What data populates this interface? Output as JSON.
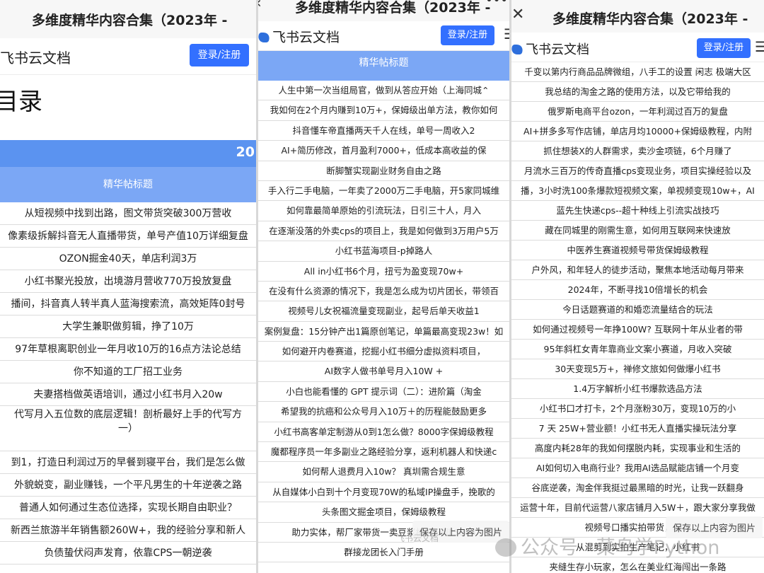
{
  "doc_title": "多维度精华内容合集（2023年 -",
  "app_name": "飞书云文档",
  "login_label": "登录/注册",
  "panel1": {
    "toc_heading": "目录",
    "year_fragment": "20",
    "column_header": "精华帖标题",
    "rows": [
      "从短视频中找到出路，图文带货突破300万营收",
      "像素级拆解抖音无人直播带货，单号产值10万详细复盘",
      "OZON掘金40天，单店利润3万",
      "小红书聚光投放，出境游月营收770万投放复盘",
      "播间，抖音真人转半真人蓝海搜索流，高效矩阵0封号",
      "大学生兼职做剪辑，挣了10万",
      "97年草根离职创业一年月收10万的16点方法论总结",
      "你不知道的工厂招工业务",
      "夫妻搭档做英语培训，通过小红书月入20w",
      "代写月入五位数的底层逻辑！剖析最好上手的代写方\n一）",
      "到1，打造日利润过万的早餐到寝平台，我们是怎么做",
      "外貌蜕变，副业赚钱，一个平凡男生的十年逆袭之路",
      "普通人如何通过生态位选择，实现长期自由职业？",
      "新西兰旅游半年销售额260W+，我的经验分享和新人",
      "负债蛰伏闷声发育，依靠CPS一朝逆袭"
    ]
  },
  "panel2": {
    "column_header": "精华帖标题",
    "rows": [
      "人生中第一次当组局官，做到从答应开始（上海同城⌃",
      "我如何在2个月内赚到10万+，保姆级出单方法，教你如何",
      "抖音懂车帝直播两天千人在线，单号一周收入2",
      "AI+简历修改，首月盈利7000+，低成本高收益的保",
      "断脚蟹实现副业财务自由之路",
      "手入行二手电脑，一年卖了2000万二手电脑，开5家同城维",
      "如何靠最简单原始的引流玩法，日引三十人，月入",
      "在逐渐没落的外卖cps的项目上，我是如何做到3万用户5万",
      "小红书蓝海项目-p掉路人",
      "All in小红书6个月，扭亏为盈变现70w+",
      "在没有什么资源的情况下，我是怎么成为切片团长，带领百",
      "视频号儿女祝福流量变现副业，起号后单天收益1",
      "案例复盘：15分钟产出1篇原创笔记，单篇最高变现23w！如",
      "如何避开内卷赛道，挖掘小红书细分虚拟资料项目，",
      "AI数字人做书单号月入10W +",
      "小白也能看懂的 GPT 提示词（二）：进阶篇（淘金",
      "希望我的抗癌和公众号月入10万＋的历程能鼓励更多",
      "小红书高客单定制游从0到1怎么做？8000字保姆级教程",
      "魔都程序员一年多副业之路经验分享，返利机器人和快递c",
      "如何帮人退费月入10w？ 真圳需合规生意",
      "从自媒体小白到十个月变现70W的私域IP操盘手，挽歌的",
      "头条图文掘金项目，保姆级教程",
      "助力实体，帮厂家带货一卖豆浆机20天赚5000",
      "群接龙团长入门手册"
    ],
    "toast": "保存以上内容为图片"
  },
  "panel3": {
    "rows": [
      "千变以第内行商品品牌微组，八手工的设置 闲志 极端大区",
      "我总结的淘金之路的使用方法，以及它带给我的",
      "俄罗斯电商平台ozon，一年利润过百万的复盘",
      "AI+拼多多写作店铺，单店月均10000+保姆级教程，内附",
      "抓住想装X的人群需求，卖沙金项链，6个月赚了",
      "月流水三百万的传奇直播cps变现业务，项目实操经验以及",
      "播，3小时洗100条爆款短视频文案，单视频变现10w+，AI",
      "蓝先生快递cps--超十种线上引流实战技巧",
      "藏在同城里的刚需生意，如何用互联网来快速放",
      "中医养生赛道视频号带货保姆级教程",
      "户外风，和年轻人的徒步活动，聚焦本地活动每月带来",
      "2024年，不断寻找10倍增长的机会",
      "今日话题赛道的和婚恋流量结合的玩法",
      "如何通过视频号一年挣100W? 互联网十年从业者的带",
      "95年斜杠女青年靠商业文案小赛道，月收入突破",
      "30天变现5万+，禅修文旅如何做爆小红书",
      "1.4万字解析小红书爆款选品方法",
      "小红书口才打卡，2个月涨粉30万，变现10万的小",
      "7 天 25W+营业额！小红书无人直播实操玩法分享",
      "高度内耗28年的我如何摆脱内耗，实现事业和生活的",
      "AI如何切入电商行业？我用AI选品赋能店铺一个月变",
      "谷底逆袭，淘金伴我挺过最黑暗的时光，让我一跃翻身",
      "运营十年，目前代运营八家店铺月入5W＋，跟大家分享我做",
      "视频号口播实拍带货，单条",
      "从混剪到实拍生产笔记，小红书",
      "夹缝生存小玩家，怎么在美业红海闯出一条路"
    ],
    "toast": "保存以上内容为图片"
  },
  "watermark": "公众号 · 菜鸟学Python",
  "ghost_text": "飞书云文档"
}
